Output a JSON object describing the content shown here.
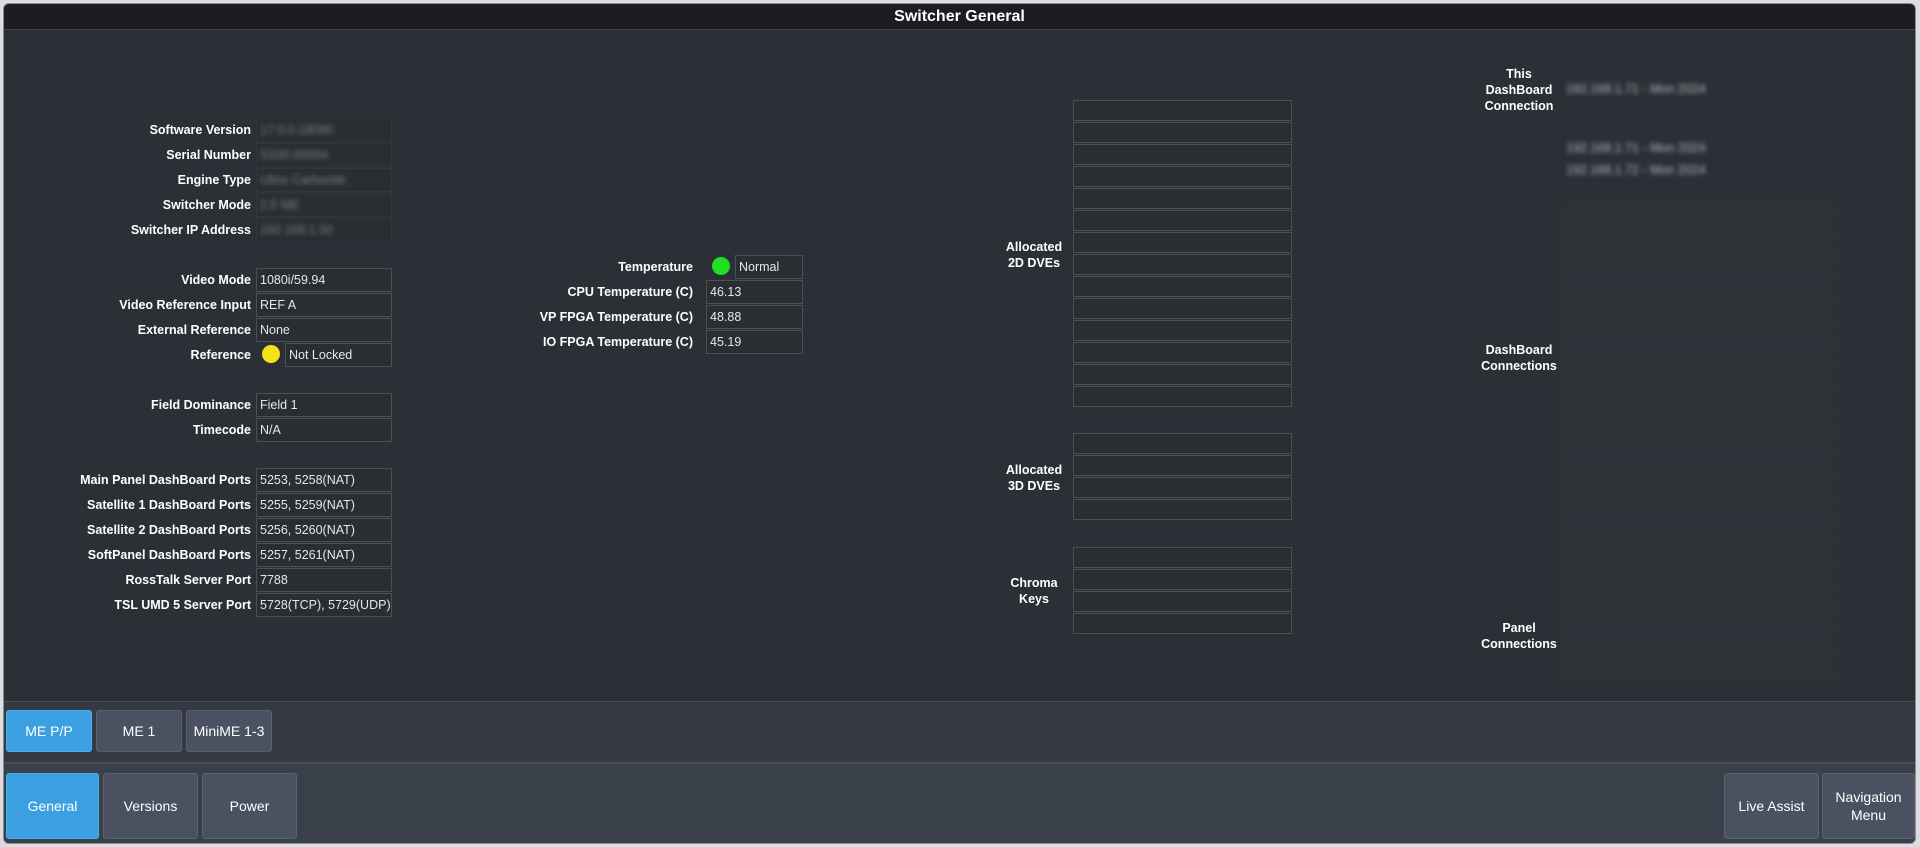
{
  "title": "Switcher General",
  "left": {
    "software_version": {
      "label": "Software Version",
      "value": "17.0.0.18080"
    },
    "serial_number": {
      "label": "Serial Number",
      "value": "S100-00054"
    },
    "engine_type": {
      "label": "Engine Type",
      "value": "Ultrix Carbonite"
    },
    "switcher_mode": {
      "label": "Switcher Mode",
      "value": "2.5 ME"
    },
    "switcher_ip": {
      "label": "Switcher IP Address",
      "value": "192.168.1.50"
    },
    "video_mode": {
      "label": "Video Mode",
      "value": "1080i/59.94"
    },
    "video_ref_input": {
      "label": "Video Reference Input",
      "value": "REF A"
    },
    "external_ref": {
      "label": "External Reference",
      "value": "None"
    },
    "reference": {
      "label": "Reference",
      "value": "Not Locked",
      "indicator_color": "#f2e21a"
    },
    "field_dominance": {
      "label": "Field Dominance",
      "value": "Field 1"
    },
    "timecode": {
      "label": "Timecode",
      "value": "N/A"
    },
    "main_panel_ports": {
      "label": "Main Panel DashBoard Ports",
      "value": "5253, 5258(NAT)"
    },
    "sat1_ports": {
      "label": "Satellite 1 DashBoard Ports",
      "value": "5255, 5259(NAT)"
    },
    "sat2_ports": {
      "label": "Satellite 2 DashBoard Ports",
      "value": "5256, 5260(NAT)"
    },
    "softpanel_ports": {
      "label": "SoftPanel DashBoard Ports",
      "value": "5257, 5261(NAT)"
    },
    "rosstalk_port": {
      "label": "RossTalk Server Port",
      "value": "7788"
    },
    "tsl_port": {
      "label": "TSL UMD 5 Server Port",
      "value": "5728(TCP), 5729(UDP)"
    }
  },
  "temps": {
    "temperature": {
      "label": "Temperature",
      "value": "Normal",
      "indicator_color": "#1ee01e"
    },
    "cpu": {
      "label": "CPU Temperature (C)",
      "value": "46.13"
    },
    "vp_fpga": {
      "label": "VP FPGA Temperature (C)",
      "value": "48.88"
    },
    "io_fpga": {
      "label": "IO FPGA Temperature (C)",
      "value": "45.19"
    }
  },
  "dve": {
    "allocated_2d_label": "Allocated\n2D DVEs",
    "allocated_3d_label": "Allocated\n3D DVEs",
    "chroma_keys_label": "Chroma\nKeys"
  },
  "connections": {
    "this_label": "This\nDashBoard\nConnection",
    "this_value": "192.168.1.71 - Mon 2024",
    "dashboard_label": "DashBoard\nConnections",
    "dashboard_values": [
      "192.168.1.71 - Mon 2024",
      "192.168.1.72 - Mon 2024"
    ],
    "panel_label": "Panel\nConnections"
  },
  "me_tabs": [
    "ME P/P",
    "ME 1",
    "MiniME 1-3"
  ],
  "nav": {
    "general": "General",
    "versions": "Versions",
    "power": "Power",
    "live_assist": "Live Assist",
    "navigation_menu": "Navigation\nMenu"
  },
  "colors": {
    "accent": "#3aa0e2",
    "background": "#2c3036"
  }
}
